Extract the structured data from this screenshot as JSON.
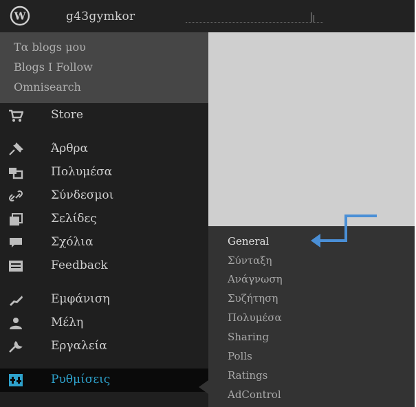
{
  "adminbar": {
    "site_name": "g43gymkor",
    "logo_icon": "wordpress-logo-icon"
  },
  "mysites_menu": {
    "items": [
      "Τα blogs μου",
      "Blogs I Follow",
      "Omnisearch"
    ]
  },
  "sidebar": {
    "items": [
      {
        "label": "Store",
        "icon": "cart-icon"
      },
      {
        "label": "Άρθρα",
        "icon": "pin-icon"
      },
      {
        "label": "Πολυμέσα",
        "icon": "media-icon"
      },
      {
        "label": "Σύνδεσμοι",
        "icon": "link-icon"
      },
      {
        "label": "Σελίδες",
        "icon": "pages-icon"
      },
      {
        "label": "Σχόλια",
        "icon": "comments-icon"
      },
      {
        "label": "Feedback",
        "icon": "feedback-icon"
      },
      {
        "label": "Εμφάνιση",
        "icon": "appearance-icon"
      },
      {
        "label": "Μέλη",
        "icon": "users-icon"
      },
      {
        "label": "Εργαλεία",
        "icon": "tools-icon"
      },
      {
        "label": "Ρυθμίσεις",
        "icon": "settings-icon",
        "active": true
      }
    ]
  },
  "submenu": {
    "items": [
      "General",
      "Σύνταξη",
      "Ανάγνωση",
      "Συζήτηση",
      "Πολυμέσα",
      "Sharing",
      "Polls",
      "Ratings",
      "AdControl"
    ]
  },
  "colors": {
    "active": "#2ea2cc",
    "arrow": "#4a8fd6"
  }
}
